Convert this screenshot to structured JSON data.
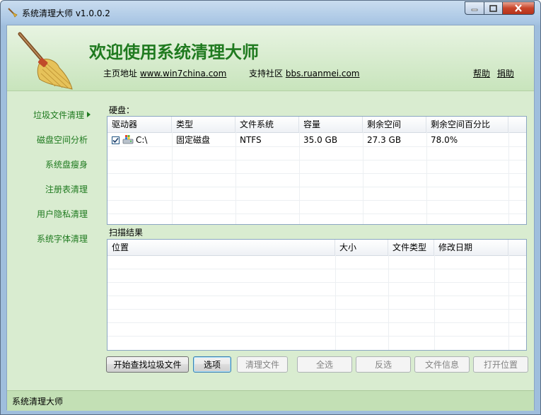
{
  "window": {
    "title": "系统清理大师 v1.0.0.2",
    "controls": {
      "minimize": "minimize",
      "maximize": "maximize",
      "close": "close"
    }
  },
  "header": {
    "welcome": "欢迎使用系统清理大师",
    "homepage_label": "主页地址",
    "homepage_link": "www.win7china.com",
    "community_label": "支持社区",
    "community_link": "bbs.ruanmei.com",
    "help": "帮助",
    "donate": "捐助"
  },
  "nav": {
    "items": [
      {
        "label": "垃圾文件清理",
        "active": true
      },
      {
        "label": "磁盘空间分析"
      },
      {
        "label": "系统盘瘦身"
      },
      {
        "label": "注册表清理"
      },
      {
        "label": "用户隐私清理"
      },
      {
        "label": "系统字体清理"
      }
    ]
  },
  "disks": {
    "label": "硬盘：",
    "columns": [
      "驱动器",
      "类型",
      "文件系统",
      "容量",
      "剩余空间",
      "剩余空间百分比"
    ],
    "rows": [
      {
        "drive": "C:\\",
        "checked": true,
        "type": "固定磁盘",
        "fs": "NTFS",
        "capacity": "35.0 GB",
        "free": "27.3 GB",
        "free_pct": "78.0%"
      }
    ]
  },
  "results": {
    "label": "扫描结果",
    "columns": [
      "位置",
      "大小",
      "文件类型",
      "修改日期"
    ]
  },
  "buttons": {
    "start_scan": "开始查找垃圾文件",
    "options": "选项",
    "clean": "清理文件",
    "select_all": "全选",
    "invert": "反选",
    "file_info": "文件信息",
    "open_location": "打开位置"
  },
  "status": {
    "text": "系统清理大师"
  },
  "colors": {
    "accent_green": "#1f7a1f",
    "status_bg": "#c3e0b5"
  }
}
